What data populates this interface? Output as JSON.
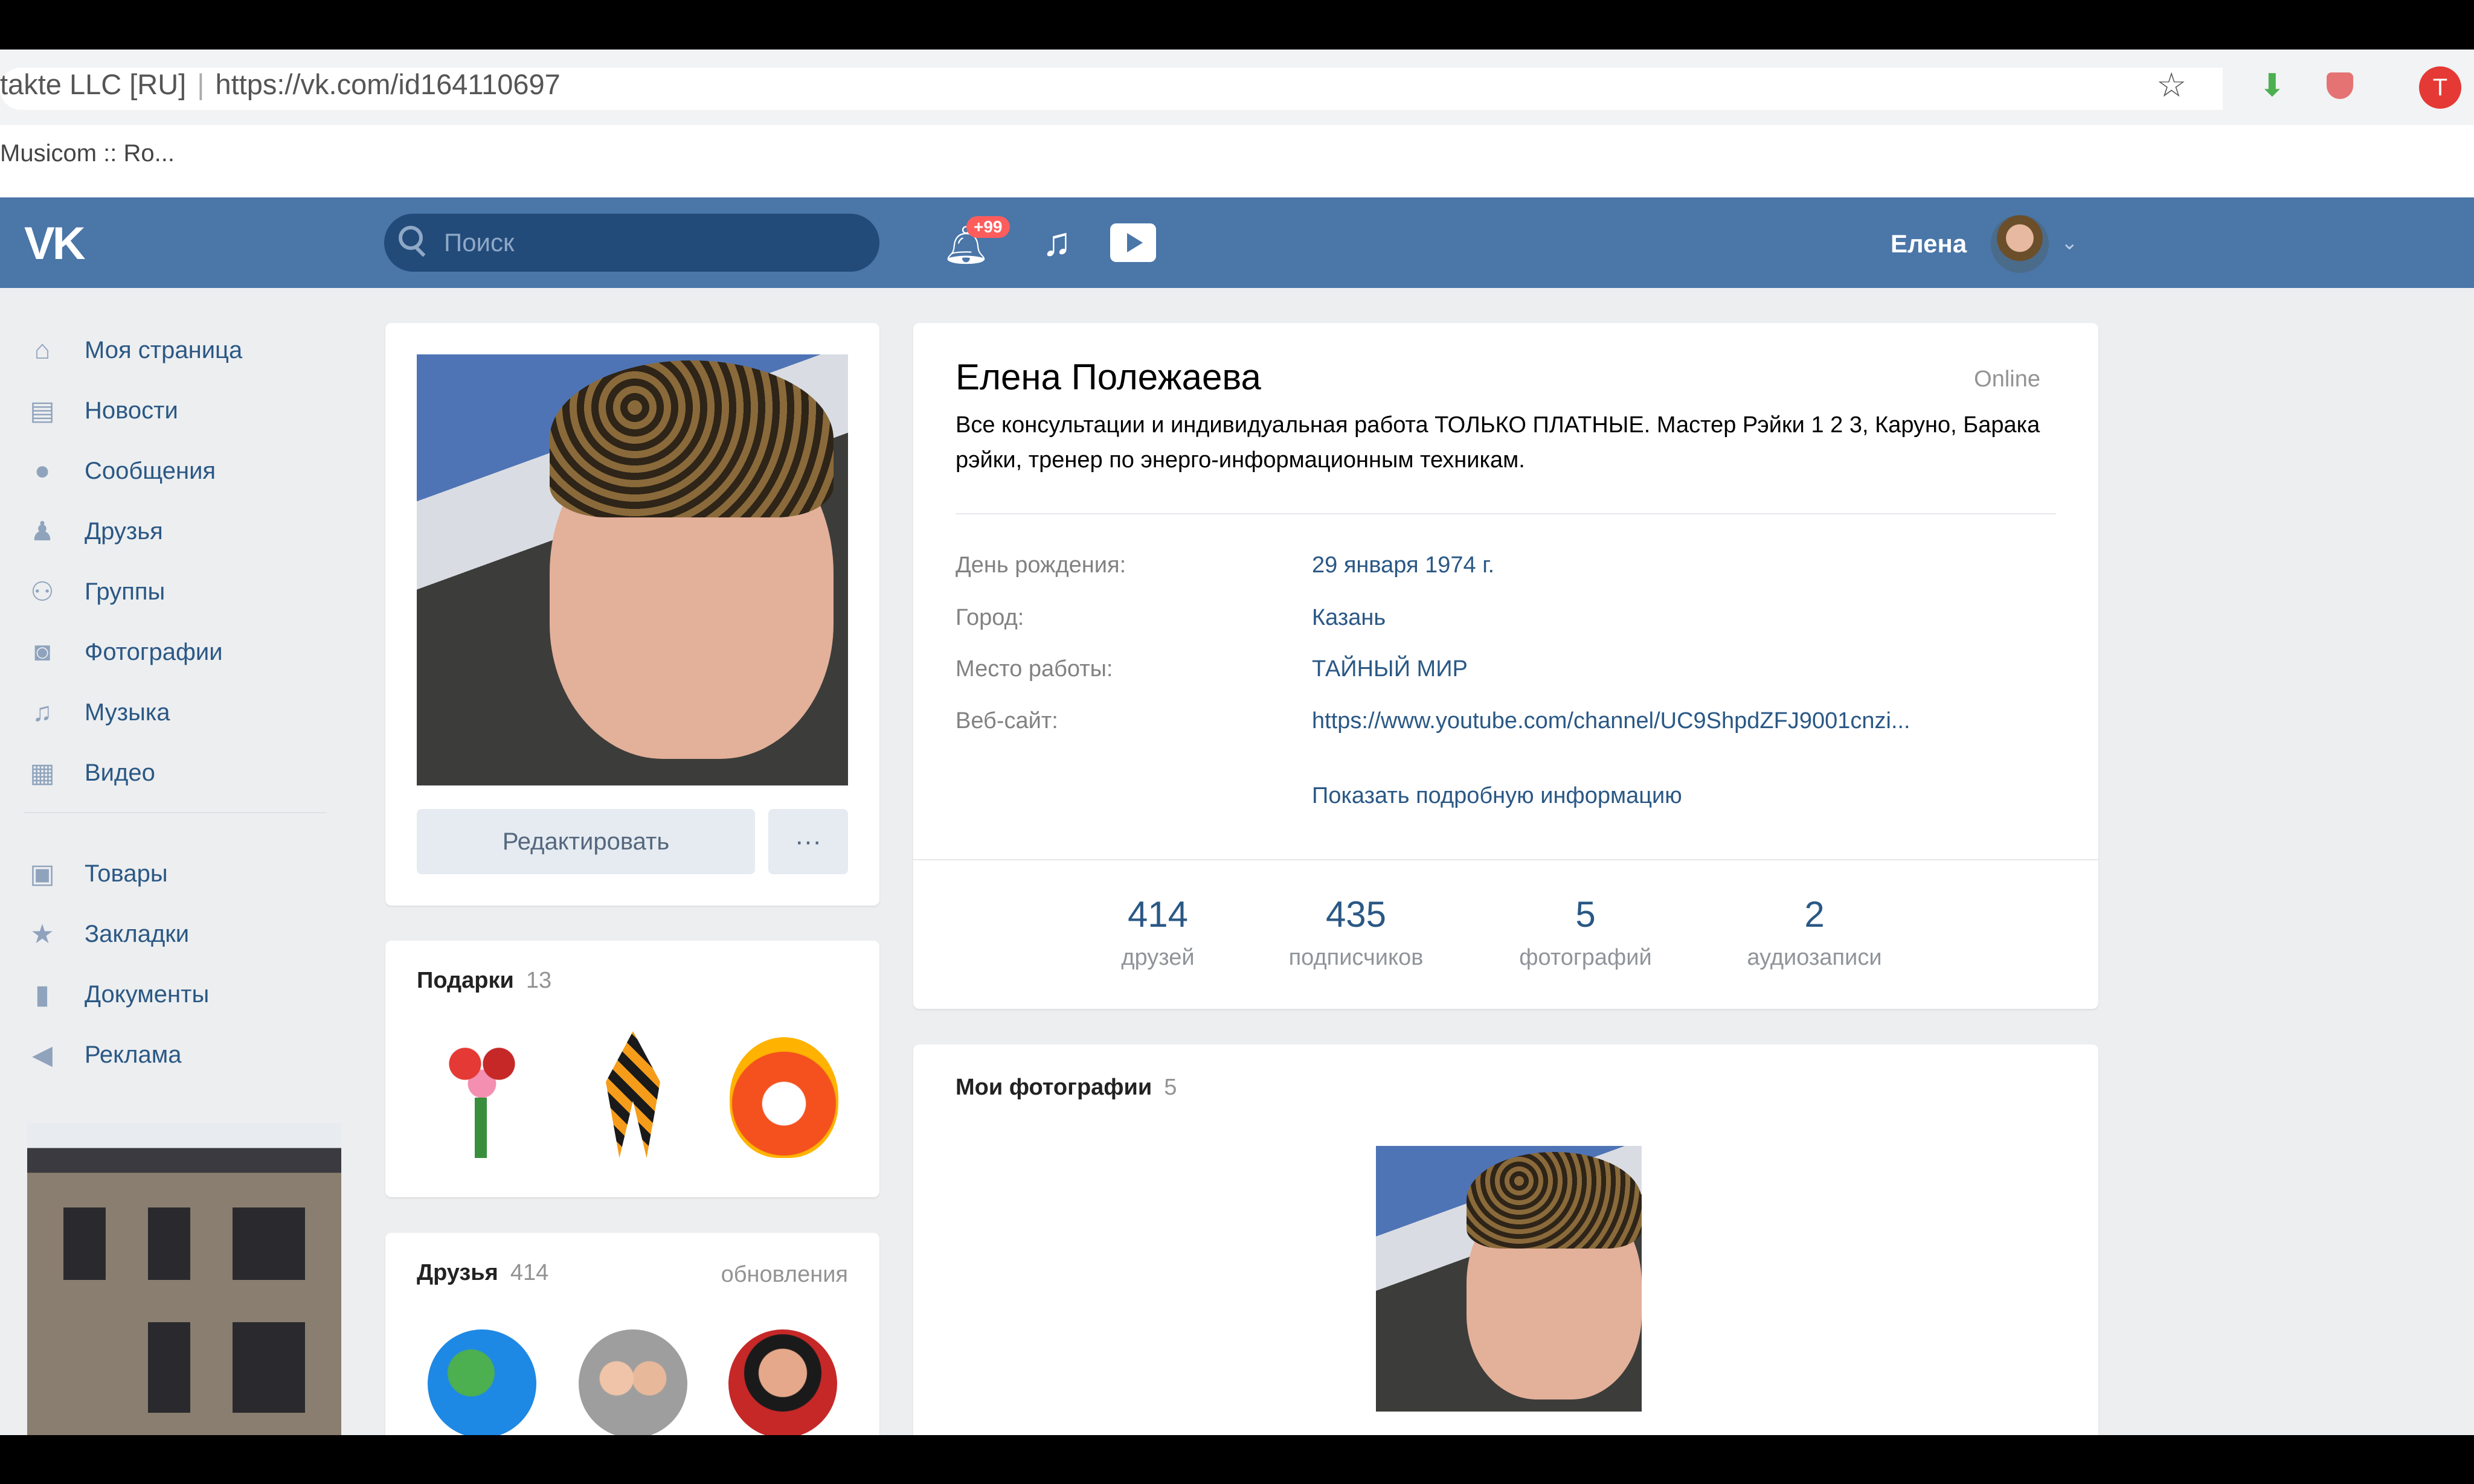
{
  "browser": {
    "site_identity": "takte LLC [RU]",
    "url": "https://vk.com/id164110697",
    "bookmark": "Musicom :: Ro...",
    "profile_initial": "T"
  },
  "header": {
    "logo": "VK",
    "search_placeholder": "Поиск",
    "notifications_badge": "+99",
    "user_name": "Елена"
  },
  "sidebar": {
    "items": [
      {
        "label": "Моя страница",
        "icon": "home-icon"
      },
      {
        "label": "Новости",
        "icon": "news-icon"
      },
      {
        "label": "Сообщения",
        "icon": "messages-icon"
      },
      {
        "label": "Друзья",
        "icon": "friends-icon"
      },
      {
        "label": "Группы",
        "icon": "groups-icon"
      },
      {
        "label": "Фотографии",
        "icon": "camera-icon"
      },
      {
        "label": "Музыка",
        "icon": "music-icon"
      },
      {
        "label": "Видео",
        "icon": "video-icon"
      },
      {
        "label": "Товары",
        "icon": "bag-icon"
      },
      {
        "label": "Закладки",
        "icon": "star-icon"
      },
      {
        "label": "Документы",
        "icon": "document-icon"
      },
      {
        "label": "Реклама",
        "icon": "megaphone-icon"
      }
    ]
  },
  "profile": {
    "edit_label": "Редактировать",
    "more_label": "···",
    "name": "Елена Полежаева",
    "status_online": "Online",
    "status_text": "Все консультации и индивидуальная работа ТОЛЬКО ПЛАТНЫЕ. Мастер Рэйки 1 2 3, Каруно, Барака рэйки, тренер по энерго-информационным техникам.",
    "info": [
      {
        "label": "День рождения:",
        "value": "29 января 1974 г."
      },
      {
        "label": "Город:",
        "value": "Казань"
      },
      {
        "label": "Место работы:",
        "value": "ТАЙНЫЙ МИР"
      },
      {
        "label": "Веб-сайт:",
        "value": "https://www.youtube.com/channel/UC9ShpdZFJ9001cnzi..."
      }
    ],
    "show_more": "Показать подробную информацию",
    "counters": [
      {
        "num": "414",
        "label": "друзей"
      },
      {
        "num": "435",
        "label": "подписчиков"
      },
      {
        "num": "5",
        "label": "фотографий"
      },
      {
        "num": "2",
        "label": "аудиозаписи"
      }
    ]
  },
  "gifts": {
    "title": "Подарки",
    "count": "13"
  },
  "friends": {
    "title": "Друзья",
    "count": "414",
    "updates": "обновления"
  },
  "photos": {
    "title": "Мои фотографии",
    "count": "5"
  },
  "colors": {
    "vk_blue": "#4a76a8",
    "link": "#2a5885",
    "background": "#edeef0"
  }
}
